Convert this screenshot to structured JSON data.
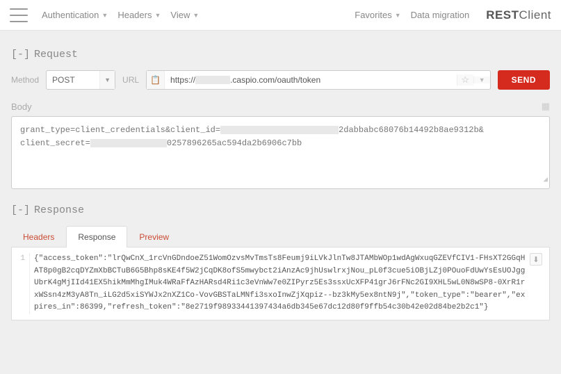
{
  "nav": {
    "authentication": "Authentication",
    "headers": "Headers",
    "view": "View",
    "favorites": "Favorites",
    "data_migration": "Data migration"
  },
  "brand_left": "REST",
  "brand_right": "Client",
  "request": {
    "title": "Request",
    "collapse": "[-]",
    "method_label": "Method",
    "method_value": "POST",
    "url_label": "URL",
    "url_prefix": "https://",
    "url_suffix": ".caspio.com/oauth/token",
    "send": "SEND"
  },
  "body": {
    "label": "Body",
    "line1_a": "grant_type=client_credentials&client_id=",
    "line1_b": "2dabbabc68076b14492b8ae9312b&",
    "line2_a": "client_secret=",
    "line2_b": "0257896265ac594da2b6906c7bb"
  },
  "response": {
    "title": "Response",
    "collapse": "[-]",
    "tabs": {
      "headers": "Headers",
      "response": "Response",
      "preview": "Preview"
    },
    "line_no": "1",
    "text": "{\"access_token\":\"lrQwCnX_1rcVnGDndoeZ51WomOzvsMvTmsTs8Feumj9iLVkJlnTw8JTAMbWOp1wdAgWxuqGZEVfCIV1-FHsXT2GGqHAT8p0gB2cqDYZmXbBCTuB6G5Bhp8sKE4f5W2jCqDK8ofS5mwybct2iAnzAc9jhUswlrxjNou_pL0f3cue5iOBjLZj0POuoFdUwYsEsUOJggUbrK4gMjIId41EX5hikMmMhgIMuk4WRaFfAzHARsd4Ri1c3eVnWw7e0ZIPyrz5Es3ssxUcXFP41grJ6rFNc2GI9XHL5wL0N8wSP8-0XrR1rxWSsn4zM3yA8Tn_iLG2d5xiSYWJx2nXZ1Co-VovGBSTaLMNfi3sxoInwZjXqpiz--bz3kMy5ex8ntN9j\",\"token_type\":\"bearer\",\"expires_in\":86399,\"refresh_token\":\"8e2719f98933441397434a6db345e67dc12d80f9ffb54c30b42e02d84be2b2c1\"}"
  }
}
